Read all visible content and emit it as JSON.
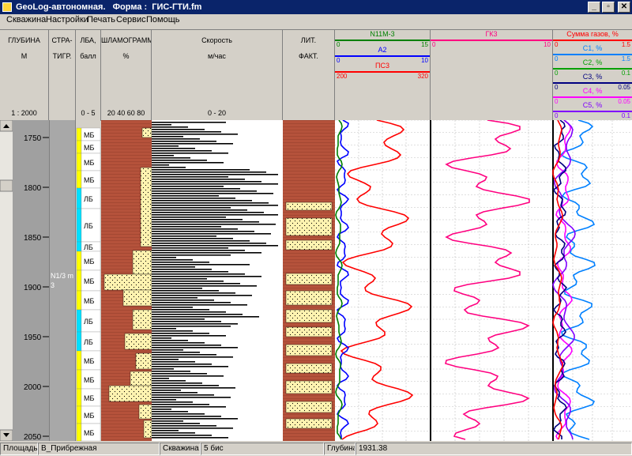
{
  "window": {
    "title": "GeoLog-автономная.   Форма :  ГИС-ГТИ.fm",
    "minimize": "_",
    "restore": "▫",
    "close": "✕"
  },
  "menu": [
    "Скважина",
    "Настройки",
    "Печать",
    "Сервис",
    "Помощь"
  ],
  "columns": {
    "depth": {
      "line1": "ГЛУБИНА",
      "line2": "М",
      "scale": "1 : 2000"
    },
    "strat": {
      "line1": "СТРА-",
      "line2": "ТИГР."
    },
    "lba": {
      "line1": "ЛБА,",
      "line2": "балл",
      "scale": "0 - 5"
    },
    "shlam": {
      "line1": "ШЛАМОГРАММА",
      "line2": "%",
      "scale": "20 40 60 80"
    },
    "speed": {
      "line1": "Скорость",
      "line2": "м/час",
      "scale": "0 - 20"
    },
    "lit": {
      "line1": "ЛИТ.",
      "line2": "ФАКТ."
    }
  },
  "curves1": [
    {
      "name": "N11M-3",
      "min": "0",
      "max": "15",
      "color": "#008000"
    },
    {
      "name": "A2",
      "min": "0",
      "max": "10",
      "color": "#0000ff"
    },
    {
      "name": "ПС3",
      "min": "200",
      "max": "320",
      "color": "#ff0000"
    }
  ],
  "curves2": [
    {
      "name": "ГК3",
      "min": "0",
      "max": "10",
      "color": "#ff0080"
    }
  ],
  "curves3": [
    {
      "name": "Сумма газов, %",
      "min": "0",
      "max": "1.5",
      "color": "#ff0000"
    },
    {
      "name": "C1, %",
      "min": "0",
      "max": "1.5",
      "color": "#0080ff"
    },
    {
      "name": "C2, %",
      "min": "0",
      "max": "0.1",
      "color": "#00a000"
    },
    {
      "name": "C3, %",
      "min": "0",
      "max": "0.05",
      "color": "#000080"
    },
    {
      "name": "C4, %",
      "min": "0",
      "max": "0.05",
      "color": "#ff00ff"
    },
    {
      "name": "C5, %",
      "min": "0",
      "max": "0.1",
      "color": "#8000ff"
    }
  ],
  "depth_ticks": [
    "1750",
    "1800",
    "1850",
    "1900",
    "1950",
    "2000",
    "2050"
  ],
  "strat_label": "N1/3 m",
  "strat_label2": "3",
  "lba_labels": [
    "МБ",
    "МБ",
    "МБ",
    "МБ",
    "ЛБ",
    "ЛБ",
    "ЛБ",
    "МБ",
    "МБ",
    "МБ",
    "ЛБ",
    "ЛБ",
    "МБ",
    "МБ",
    "МБ",
    "МБ",
    "МБ"
  ],
  "status": {
    "area_label": "Площадь",
    "area_value": "В_Прибрежная",
    "well_label": "Скважина",
    "well_value": "5 бис",
    "depth_label": "Глубина",
    "depth_value": "1931.38"
  },
  "colors": {
    "accent_titlebar": "#0a246a",
    "brick": "#b5523b",
    "sand": "#fff3b0",
    "lba_yellow": "#ffff00",
    "lba_cyan": "#00e0ff"
  }
}
